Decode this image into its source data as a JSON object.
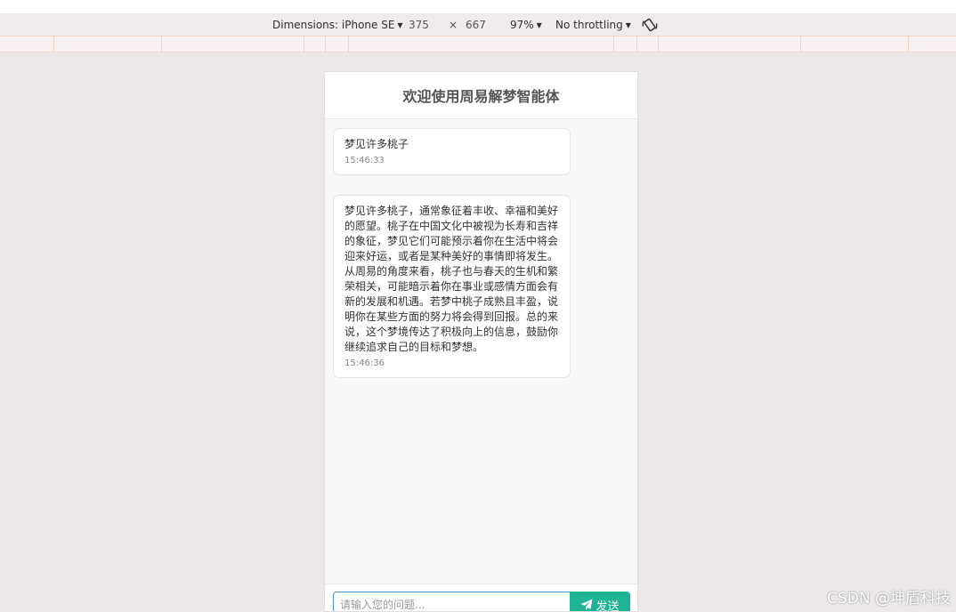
{
  "devtools": {
    "dimensions_label": "Dimensions: iPhone SE",
    "width": "375",
    "times": "×",
    "height": "667",
    "zoom": "97%",
    "throttling": "No throttling",
    "rotate_icon": "rotate-icon"
  },
  "app": {
    "title": "欢迎使用周易解梦智能体"
  },
  "messages": [
    {
      "text": "梦见许多桃子",
      "time": "15:46:33"
    },
    {
      "text": "梦见许多桃子，通常象征着丰收、幸福和美好的愿望。桃子在中国文化中被视为长寿和吉祥的象征，梦见它们可能预示着你在生活中将会迎来好运，或者是某种美好的事情即将发生。从周易的角度来看，桃子也与春天的生机和繁荣相关，可能暗示着你在事业或感情方面会有新的发展和机遇。若梦中桃子成熟且丰盈，说明你在某些方面的努力将会得到回报。总的来说，这个梦境传达了积极向上的信息，鼓励你继续追求自己的目标和梦想。",
      "time": "15:46:36"
    }
  ],
  "input": {
    "placeholder": "请输入您的问题...",
    "value": ""
  },
  "send_button": {
    "label": "发送",
    "icon": "paper-plane-icon",
    "color": "#1db394"
  },
  "watermark": "CSDN @坤盾科技"
}
